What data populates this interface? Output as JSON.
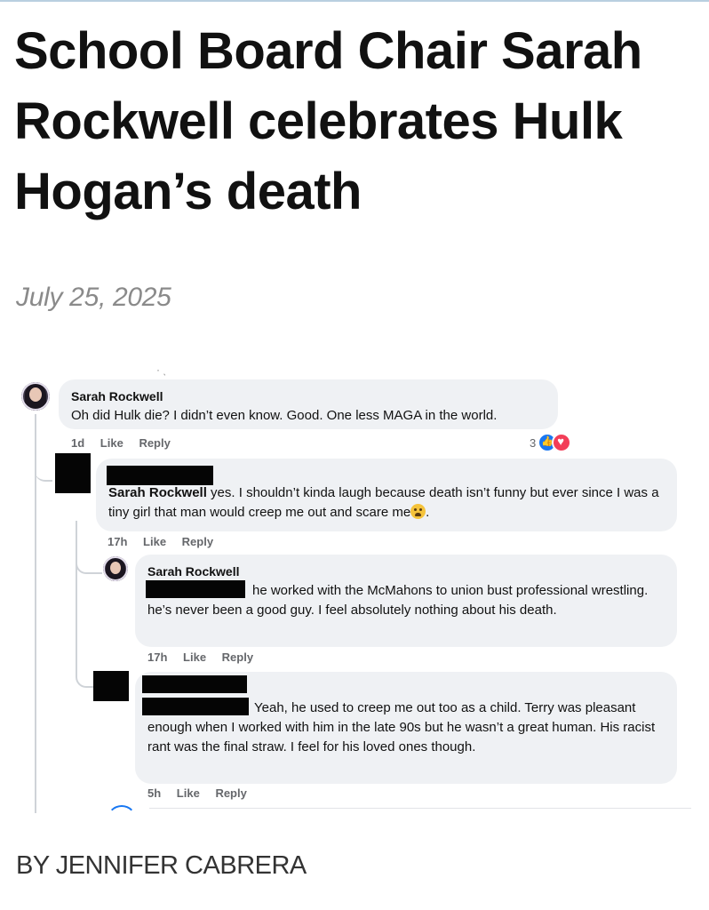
{
  "article": {
    "headline": "School Board Chair Sarah Rockwell celebrates Hulk Hogan’s death",
    "date": "July 25, 2025",
    "byline": "BY JENNIFER CABRERA"
  },
  "thread": {
    "stray_mark": "· ˎ",
    "comments": [
      {
        "author": "Sarah Rockwell",
        "text": "Oh did Hulk die? I didn’t even know. Good. One less MAGA in the world.",
        "time": "1d",
        "like_label": "Like",
        "reply_label": "Reply",
        "reaction_count": "3",
        "reactions": [
          "like-icon",
          "love-icon"
        ]
      },
      {
        "author": "[redacted]",
        "mention": "Sarah Rockwell",
        "text": " yes. I shouldn’t kinda laugh because death isn’t funny but ever since I was a tiny girl that man would creep me out and scare me",
        "text_end": ".",
        "emoji": "fearful-face-emoji",
        "time": "17h",
        "like_label": "Like",
        "reply_label": "Reply"
      },
      {
        "author": "Sarah Rockwell",
        "text": "he worked with the McMahons to union bust professional wrestling. he’s never been a good guy. I feel absolutely nothing about his death.",
        "time": "17h",
        "like_label": "Like",
        "reply_label": "Reply"
      },
      {
        "author": "[redacted]",
        "text": "Yeah, he used to creep me out too as a child. Terry was pleasant enough when I worked with him in the late 90s but he wasn’t a great human. His racist rant was the final straw. I feel for his loved ones though.",
        "time": "5h",
        "like_label": "Like",
        "reply_label": "Reply"
      }
    ]
  }
}
